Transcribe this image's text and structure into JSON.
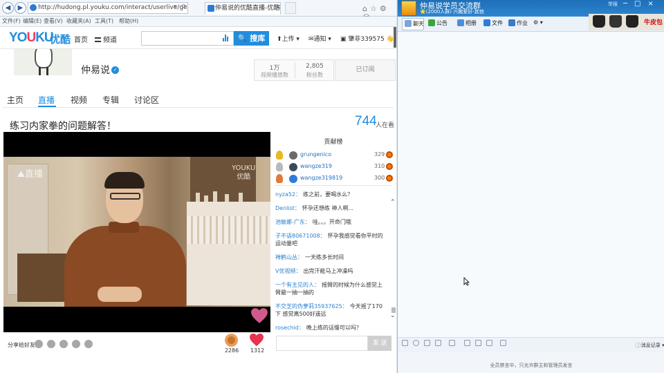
{
  "browser": {
    "url": "http://hudong.pl.youku.com/interact/userlive/get/room/u/Uk",
    "tab_title": "仲易说的优酷直播-优酷视频",
    "tab_close": "×",
    "nav_back": "◀",
    "nav_forward": "▶",
    "menu": [
      "文件(F)",
      "编辑(E)",
      "查看(V)",
      "收藏夹(A)",
      "工具(T)",
      "帮助(H)"
    ]
  },
  "youku": {
    "logo": "YOUKU",
    "logo_cn": "优酷",
    "nav_home": "首页",
    "nav_channel": "频道",
    "search_placeholder": "",
    "search_button": "搜库",
    "upload": "上传",
    "notify": "通知",
    "user": "肇非339575"
  },
  "channel": {
    "name": "仲易说",
    "stats": [
      {
        "value": "1万",
        "label": "视频播放数"
      },
      {
        "value": "2,805",
        "label": "粉丝数"
      }
    ],
    "subscribed": "已订阅",
    "tabs": [
      "主页",
      "直播",
      "视频",
      "专辑",
      "讨论区"
    ],
    "active_tab": "直播"
  },
  "live": {
    "title": "练习内家拳的问题解答！",
    "viewers": "744",
    "viewers_label": "人在看",
    "watermark_left": "直播",
    "watermark_right_1": "YOUKU",
    "watermark_right_2": "优酷"
  },
  "ranking": {
    "title": "贡献榜",
    "entries": [
      {
        "name": "grungenico",
        "score": "329",
        "medal_color": "#e8b923",
        "avatar_color": "#6b6b6b"
      },
      {
        "name": "wangze319",
        "score": "310",
        "medal_color": "#b9b9b9",
        "avatar_color": "#3a4a5a"
      },
      {
        "name": "wangze319819",
        "score": "300",
        "medal_color": "#e07a3a",
        "avatar_color": "#2f7bd6"
      }
    ]
  },
  "chat": {
    "messages": [
      {
        "user": "nyza52：",
        "text": "练之前，要喝水么？"
      },
      {
        "user": "Denlist：",
        "text": "怀孕还想练 神人啊..."
      },
      {
        "user": "池敏娜-广东：",
        "text": "哇。。。开命门哦"
      },
      {
        "user": "子不语80671008：",
        "text": "怀孕我感觉看你平时的运动量吧"
      },
      {
        "user": "禅鹤山丛：",
        "text": "一天练多长时间"
      },
      {
        "user": "V优视频：",
        "text": "出完汗能马上冲澡吗"
      },
      {
        "user": "一个有主见的人：",
        "text": "摇臂的时候为什么感觉上臂最一抽一抽的"
      },
      {
        "user": "不交芝的伪萝莉35937625：",
        "text": "今天摇了170下 感觉离500好遥远"
      },
      {
        "user": "rosechid：",
        "text": "晚上练的话慢可以吗？"
      }
    ],
    "send": "发 送"
  },
  "share": {
    "label": "分享给好友"
  },
  "gifts": [
    {
      "name": "donut",
      "count": "2286"
    },
    {
      "name": "heart",
      "count": "1312"
    }
  ],
  "qq": {
    "title": "仲易说学员交流群",
    "subtitle": "⭐(2000人群) 兴趣爱好-其他",
    "report": "举报",
    "tabs": [
      "聊天",
      "公告",
      "相册",
      "文件",
      "作业"
    ],
    "ad_text": "牛皮包",
    "history": "消息记录 ▾",
    "notice": "全员禁言中，只允许群主和管理员发言"
  },
  "colors": {
    "youku_blue": "#1f8de0",
    "youku_red": "#f13c5b",
    "qq_blue": "#1d6fb8"
  }
}
